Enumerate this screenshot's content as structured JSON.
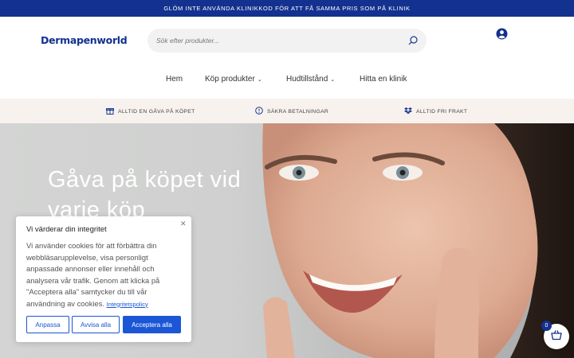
{
  "announcement": "GLÖM INTE ANVÄNDA KLINIKKOD FÖR ATT FÅ SAMMA PRIS SOM PÅ KLINIK",
  "header": {
    "logo": "Dermapenworld",
    "search_placeholder": "Sök efter produkter...",
    "search_icon": "search-icon",
    "account_icon": "user-circle-icon"
  },
  "nav": {
    "items": [
      {
        "label": "Hem",
        "dropdown": false
      },
      {
        "label": "Köp produkter",
        "dropdown": true
      },
      {
        "label": "Hudtillstånd",
        "dropdown": true
      },
      {
        "label": "Hitta en klinik",
        "dropdown": false
      }
    ]
  },
  "usp": {
    "items": [
      {
        "icon": "gift-icon",
        "label": "ALLTID EN GÅVA PÅ KÖPET"
      },
      {
        "icon": "shield-icon",
        "label": "SÄKRA BETALNINGAR"
      },
      {
        "icon": "dropbox-box-icon",
        "label": "ALLTID FRI FRAKT"
      }
    ]
  },
  "hero": {
    "title": "Gåva på köpet vid varje köp"
  },
  "cookie": {
    "title": "Vi värderar din integritet",
    "body": "Vi använder cookies för att förbättra din webbläsarupplevelse, visa personligt anpassade annonser eller innehåll och analysera vår trafik. Genom att klicka på \"Acceptera alla\" samtycker du till vår användning av cookies. ",
    "policy_link": "Integritetspolicy",
    "buttons": {
      "customize": "Anpassa",
      "reject": "Avvisa alla",
      "accept": "Acceptera alla"
    }
  },
  "cart": {
    "count": "0",
    "icon": "shopping-basket-icon"
  },
  "colors": {
    "brand_navy": "#13318f",
    "accent_blue": "#1a56d6",
    "usp_bg": "#f8f2ef"
  }
}
